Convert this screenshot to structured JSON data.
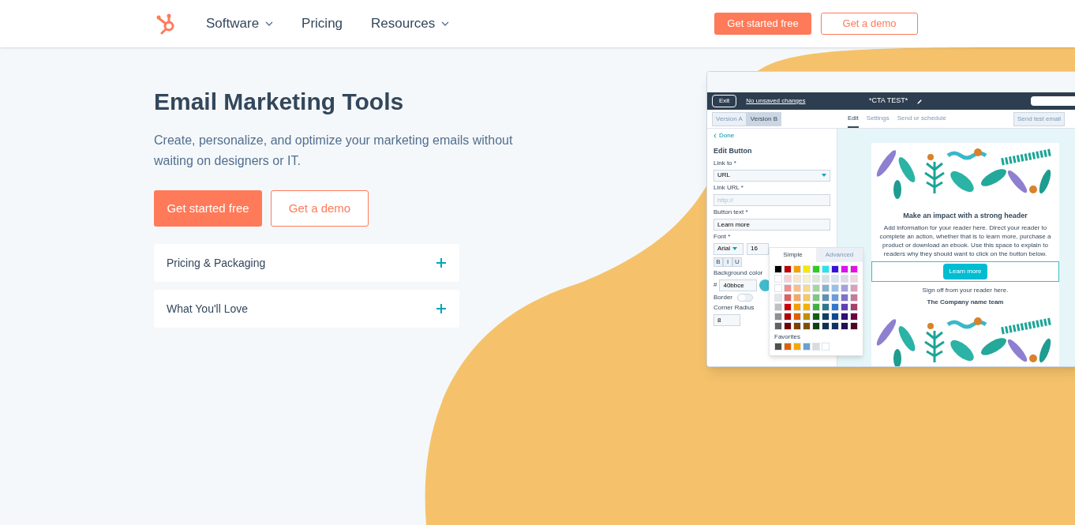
{
  "nav": {
    "items": [
      {
        "label": "Software",
        "dropdown": true
      },
      {
        "label": "Pricing",
        "dropdown": false
      },
      {
        "label": "Resources",
        "dropdown": true
      }
    ],
    "primary_button": "Get started free",
    "secondary_button": "Get a demo"
  },
  "hero": {
    "title": "Email Marketing Tools",
    "description": "Create, personalize, and optimize your marketing emails without waiting on designers or IT.",
    "primary_button": "Get started free",
    "secondary_button": "Get a demo",
    "accordion": [
      {
        "label": "Pricing & Packaging",
        "expanded": false
      },
      {
        "label": "What You'll Love",
        "expanded": false
      }
    ]
  },
  "editor": {
    "exit": "Exit",
    "status": "No unsaved changes",
    "title": "*CTA TEST*",
    "versions": [
      {
        "label": "Version A",
        "selected": false
      },
      {
        "label": "Version B",
        "selected": true
      }
    ],
    "tabs": [
      {
        "label": "Edit",
        "selected": true
      },
      {
        "label": "Settings",
        "selected": false
      },
      {
        "label": "Send or schedule",
        "selected": false
      }
    ],
    "test_button": "Send test email",
    "panel": {
      "back": "Done",
      "heading": "Edit Button",
      "link_to_label": "Link to *",
      "link_to_value": "URL",
      "link_url_label": "Link URL *",
      "link_url_placeholder": "http://",
      "button_text_label": "Button text *",
      "button_text_value": "Learn more",
      "font_label": "Font *",
      "font_value": "Arial",
      "font_size": "16",
      "styles": [
        "B",
        "I",
        "U"
      ],
      "bg_label": "Background color",
      "hash": "#",
      "bg_value": "40bbce",
      "border_label": "Border",
      "border_on": false,
      "radius_label": "Corner Radius",
      "radius_value": "8"
    },
    "picker": {
      "tabs": [
        {
          "label": "Simple",
          "selected": true
        },
        {
          "label": "Advanced",
          "selected": false
        }
      ],
      "favorites_label": "Favorites"
    },
    "email": {
      "heading": "Make an impact with a strong header",
      "body": "Add information for your reader here. Direct your reader to complete an action, whether that is to learn more, purchase a product or download an ebook. Use this space to explain to readers why they should want to click on the button below.",
      "button": "Learn more",
      "signoff": "Sign off from your reader here.",
      "team": "The Company name team"
    }
  }
}
